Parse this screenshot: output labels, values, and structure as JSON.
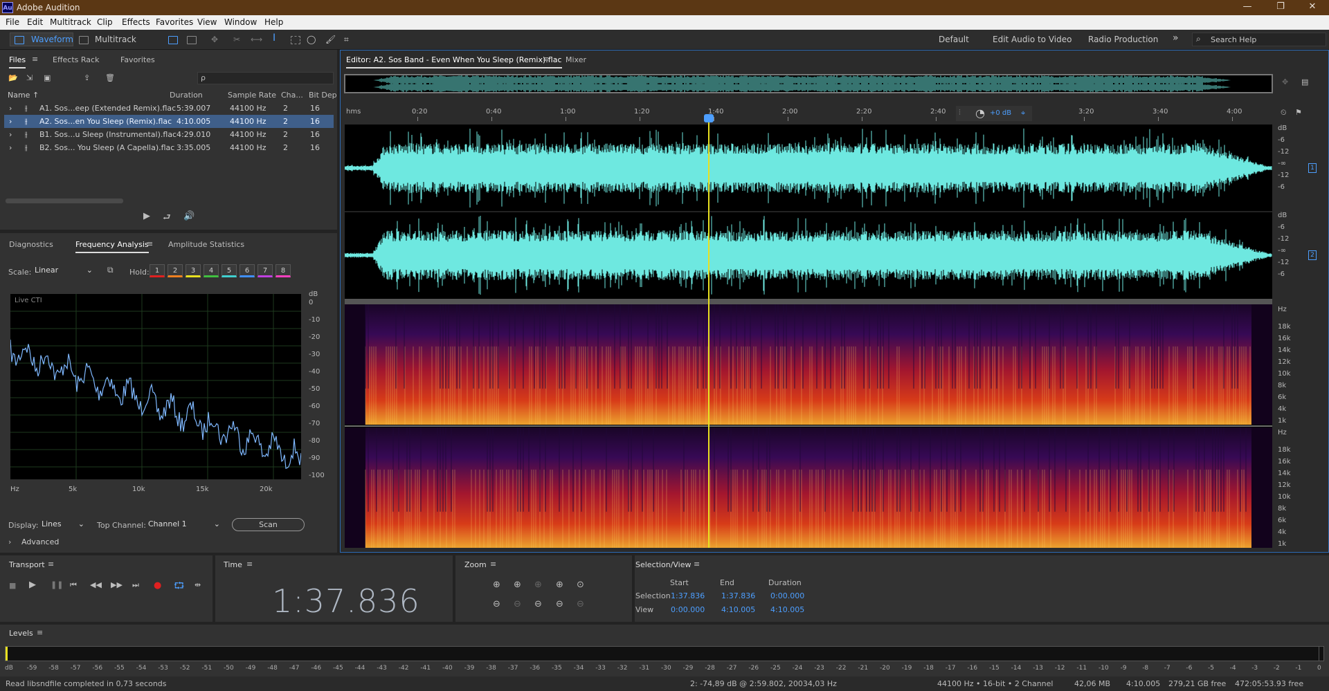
{
  "app": {
    "title": "Adobe Audition",
    "logo": "Au"
  },
  "menu": [
    "File",
    "Edit",
    "Multitrack",
    "Clip",
    "Effects",
    "Favorites",
    "View",
    "Window",
    "Help"
  ],
  "toolbar": {
    "waveform": "Waveform",
    "multitrack": "Multitrack",
    "workspaces": [
      "Default",
      "Edit Audio to Video",
      "Radio Production"
    ],
    "search_placeholder": "Search Help"
  },
  "files_panel": {
    "tabs": [
      "Files",
      "Effects Rack",
      "Favorites"
    ],
    "search_placeholder": "ρ",
    "columns": [
      "Name ↑",
      "Duration",
      "Sample Rate",
      "Cha...",
      "Bit Dep"
    ],
    "rows": [
      {
        "name": "A1. Sos...eep (Extended Remix).flac",
        "duration": "5:39.007",
        "rate": "44100 Hz",
        "ch": "2",
        "bit": "16"
      },
      {
        "name": "A2. Sos...en You Sleep (Remix).flac",
        "duration": "4:10.005",
        "rate": "44100 Hz",
        "ch": "2",
        "bit": "16"
      },
      {
        "name": "B1. Sos...u Sleep (Instrumental).flac",
        "duration": "4:29.010",
        "rate": "44100 Hz",
        "ch": "2",
        "bit": "16"
      },
      {
        "name": "B2. Sos... You Sleep (A Capella).flac",
        "duration": "3:35.005",
        "rate": "44100 Hz",
        "ch": "2",
        "bit": "16"
      }
    ]
  },
  "freq": {
    "tabs": [
      "Diagnostics",
      "Frequency Analysis",
      "Amplitude Statistics"
    ],
    "scale_label": "Scale:",
    "scale_value": "Linear",
    "hold_label": "Hold:",
    "hold": [
      "1",
      "2",
      "3",
      "4",
      "5",
      "6",
      "7",
      "8"
    ],
    "hold_colors": [
      "#e02020",
      "#f08020",
      "#e8e020",
      "#40c040",
      "#40d0d0",
      "#4090ff",
      "#c040e0",
      "#ff40c0"
    ],
    "live": "Live CTI",
    "db_unit": "dB",
    "db_ticks": [
      "0",
      "-10",
      "-20",
      "-30",
      "-40",
      "-50",
      "-60",
      "-70",
      "-80",
      "-90",
      "-100"
    ],
    "x_ticks": [
      "Hz",
      "5k",
      "10k",
      "15k",
      "20k"
    ],
    "display_label": "Display:",
    "display_value": "Lines",
    "top_channel_label": "Top Channel:",
    "top_channel_value": "Channel 1",
    "scan": "Scan",
    "advanced": "Advanced"
  },
  "editor": {
    "tab": "Editor: A2. Sos Band - Even When You Sleep (Remix).flac",
    "mixer": "Mixer",
    "ruler": [
      "hms",
      "0:20",
      "0:40",
      "1:00",
      "1:20",
      "1:40",
      "2:00",
      "2:20",
      "2:40",
      "3:00",
      "3:20",
      "3:40",
      "4:00"
    ],
    "gain": "+0 dB",
    "db_scale": [
      "dB",
      "-6",
      "-12",
      "-∞",
      "-12",
      "-6"
    ],
    "channels": [
      "1",
      "2"
    ],
    "hz_scale": [
      "Hz",
      "18k",
      "16k",
      "14k",
      "12k",
      "10k",
      "8k",
      "6k",
      "4k",
      "1k"
    ]
  },
  "transport": {
    "title": "Transport"
  },
  "time": {
    "title": "Time",
    "value": "1:37.836"
  },
  "zoom": {
    "title": "Zoom"
  },
  "selection": {
    "title": "Selection/View",
    "cols": [
      "Start",
      "End",
      "Duration"
    ],
    "selection_label": "Selection",
    "selection": [
      "1:37.836",
      "1:37.836",
      "0:00.000"
    ],
    "view_label": "View",
    "view": [
      "0:00.000",
      "4:10.005",
      "4:10.005"
    ]
  },
  "levels": {
    "title": "Levels",
    "ticks": [
      "dB",
      "-59",
      "-58",
      "-57",
      "-56",
      "-55",
      "-54",
      "-53",
      "-52",
      "-51",
      "-50",
      "-49",
      "-48",
      "-47",
      "-46",
      "-45",
      "-44",
      "-43",
      "-42",
      "-41",
      "-40",
      "-39",
      "-38",
      "-37",
      "-36",
      "-35",
      "-34",
      "-33",
      "-32",
      "-31",
      "-30",
      "-29",
      "-28",
      "-27",
      "-26",
      "-25",
      "-24",
      "-23",
      "-22",
      "-21",
      "-20",
      "-19",
      "-18",
      "-17",
      "-16",
      "-15",
      "-14",
      "-13",
      "-12",
      "-11",
      "-10",
      "-9",
      "-8",
      "-7",
      "-6",
      "-5",
      "-4",
      "-3",
      "-2",
      "-1",
      "0"
    ]
  },
  "status": {
    "left": "Read libsndfile completed in 0,73 seconds",
    "cursor": "2: -74,89 dB @ 2:59.802, 20034,03 Hz",
    "format": "44100 Hz • 16-bit • 2 Channel",
    "size": "42,06 MB",
    "dur": "4:10.005",
    "free": "279,21 GB free",
    "free_time": "472:05:53.93 free"
  },
  "colors": {
    "waveform": "#6ee8e0",
    "playhead": "#e8e020",
    "accent": "#4d9fff"
  }
}
